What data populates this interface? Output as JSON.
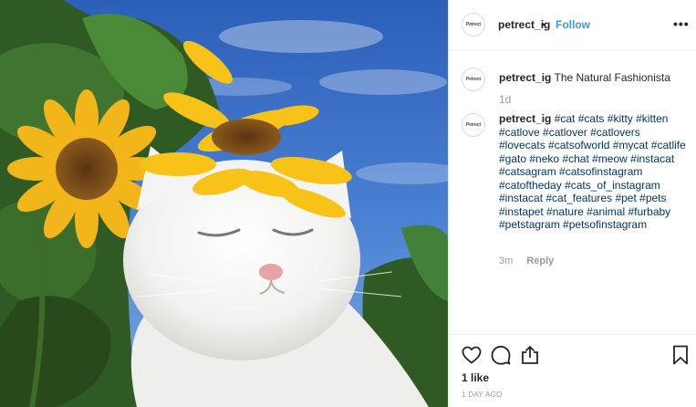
{
  "post": {
    "username": "petrect_ig",
    "separator": "•",
    "follow_label": "Follow",
    "more_label": "•••",
    "avatar_text": "Petrect"
  },
  "caption": {
    "username": "petrect_ig",
    "text": "The Natural Fashionista",
    "age": "1d"
  },
  "comment": {
    "username": "petrect_ig",
    "hashtags": [
      "#cat",
      "#cats",
      "#kitty",
      "#kitten",
      "#catlove",
      "#catlover",
      "#catlovers",
      "#lovecats",
      "#catsofworld",
      "#mycat",
      "#catlife",
      "#gato",
      "#neko",
      "#chat",
      "#meow",
      "#instacat",
      "#catsagram",
      "#catsofinstagram",
      "#catoftheday",
      "#cats_of_instagram",
      "#instacat",
      "#cat_features",
      "#pet",
      "#pets",
      "#instapet",
      "#nature",
      "#animal",
      "#furbaby",
      "#petstagram",
      "#petsofinstagram"
    ],
    "age": "3m",
    "reply_label": "Reply"
  },
  "actions": {
    "like_icon": "heart-outline",
    "comment_icon": "speech-bubble",
    "share_icon": "share-arrow",
    "save_icon": "bookmark",
    "likes": "1 like",
    "posted": "1 DAY AGO"
  },
  "colors": {
    "link": "#3897f0",
    "hashtag": "#003569",
    "muted": "#999999",
    "text": "#262626",
    "border": "#efefef"
  }
}
